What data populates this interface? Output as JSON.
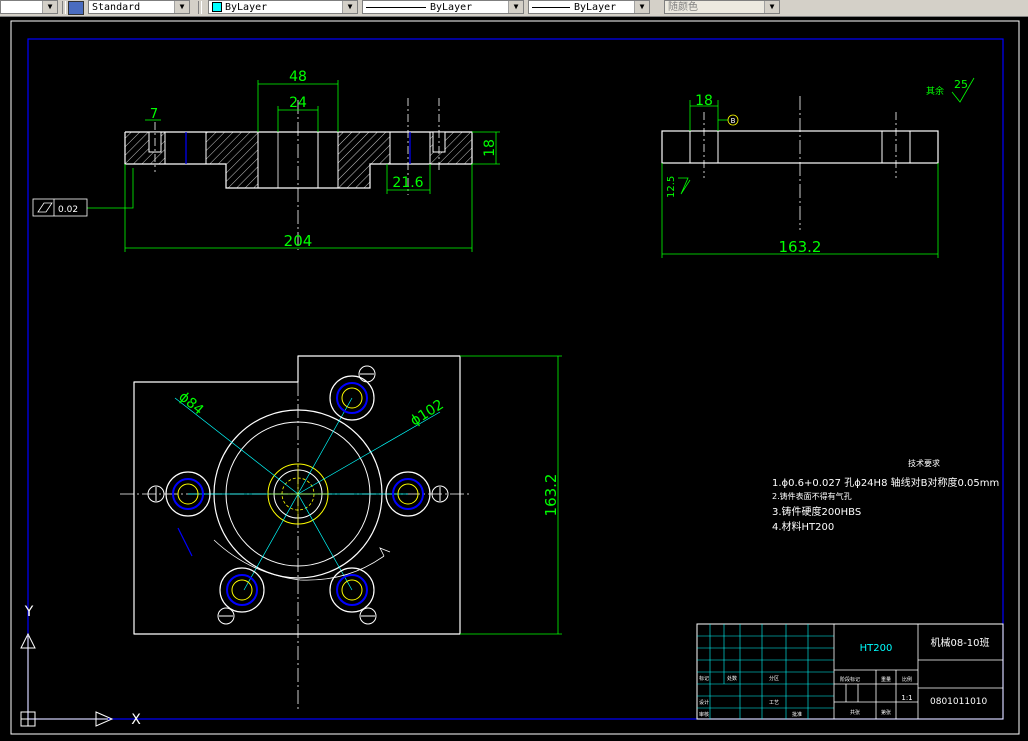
{
  "toolbar": {
    "text_style": "Standard",
    "layer": "ByLayer",
    "linetype": "ByLayer",
    "lineweight": "ByLayer",
    "plot_color": "随颜色"
  },
  "drawing": {
    "front": {
      "d48": "48",
      "d24": "24",
      "d7": "7",
      "d18": "18",
      "d216": "21.6",
      "d204": "204",
      "flat": "0.02"
    },
    "side": {
      "d18": "18",
      "datum": "B",
      "d1632": "163.2",
      "r125": "12.5",
      "r25": "25",
      "rest": "其余"
    },
    "plan": {
      "phi84": "ϕ84",
      "phi102": "ϕ102",
      "d1632": "163.2"
    },
    "tech": {
      "title": "技术要求",
      "line1": "1.ϕ0.6+0.027 孔ϕ24H8 轴线对B对称度0.05mm",
      "line2": "2.铸件表面不得有气孔",
      "line3": "3.铸件硬度200HBS",
      "line4": "4.材料HT200"
    },
    "title_block": {
      "material": "HT200",
      "name": "机械08-10班",
      "code": "0801011010",
      "scale": "1:1",
      "c1": "标记",
      "c2": "处数",
      "c3": "分区",
      "c4": "阶段标记",
      "c5": "重量",
      "c6": "比例",
      "c7": "共张",
      "c8": "第张",
      "c9": "设计",
      "c10": "审核",
      "c11": "工艺",
      "c12": "批准"
    }
  },
  "ucs": {
    "x": "X",
    "y": "Y"
  }
}
